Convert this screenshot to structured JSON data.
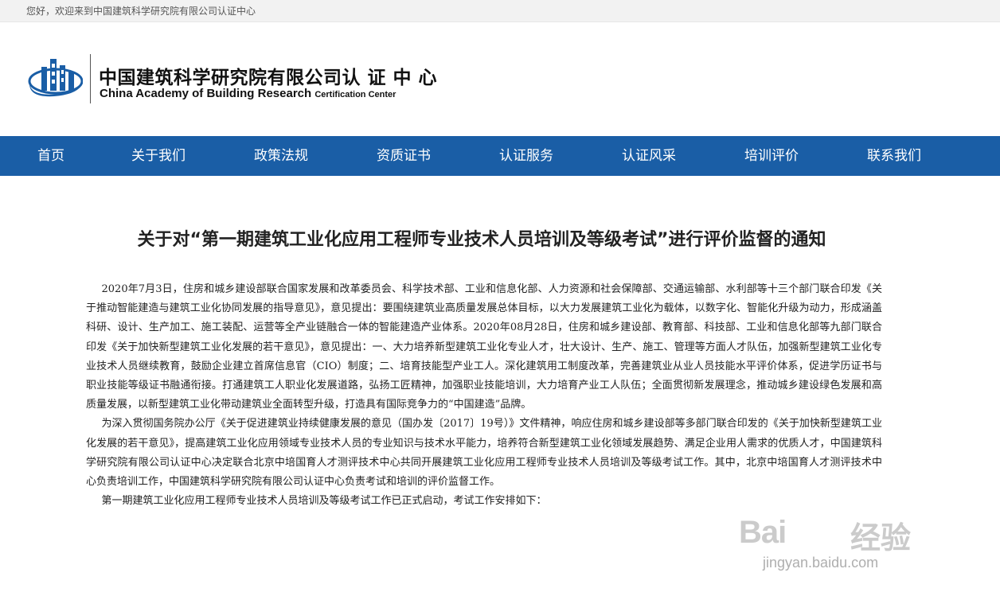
{
  "topbar": {
    "welcome": "您好，欢迎来到中国建筑科学研究院有限公司认证中心"
  },
  "header": {
    "logo_cn": "中国建筑科学研究院有限公司认 证 中 心",
    "logo_en_main": "China Academy of Building Research ",
    "logo_en_small": "Certification Center"
  },
  "nav": {
    "items": [
      {
        "label": "首页"
      },
      {
        "label": "关于我们"
      },
      {
        "label": "政策法规"
      },
      {
        "label": "资质证书"
      },
      {
        "label": "认证服务"
      },
      {
        "label": "认证风采"
      },
      {
        "label": "培训评价"
      },
      {
        "label": "联系我们"
      }
    ]
  },
  "article": {
    "title": "关于对“第一期建筑工业化应用工程师专业技术人员培训及等级考试”进行评价监督的通知",
    "paragraphs": [
      "2020年7月3日，住房和城乡建设部联合国家发展和改革委员会、科学技术部、工业和信息化部、人力资源和社会保障部、交通运输部、水利部等十三个部门联合印发《关于推动智能建造与建筑工业化协同发展的指导意见》，意见提出：要围绕建筑业高质量发展总体目标，以大力发展建筑工业化为载体，以数字化、智能化升级为动力，形成涵盖科研、设计、生产加工、施工装配、运营等全产业链融合一体的智能建造产业体系。2020年08月28日，住房和城乡建设部、教育部、科技部、工业和信息化部等九部门联合印发《关于加快新型建筑工业化发展的若干意见》，意见提出：一、大力培养新型建筑工业化专业人才，壮大设计、生产、施工、管理等方面人才队伍，加强新型建筑工业化专业技术人员继续教育，鼓励企业建立首席信息官（CIO）制度；二、培育技能型产业工人。深化建筑用工制度改革，完善建筑业从业人员技能水平评价体系，促进学历证书与职业技能等级证书融通衔接。打通建筑工人职业化发展道路，弘扬工匠精神，加强职业技能培训，大力培育产业工人队伍；全面贯彻新发展理念，推动城乡建设绿色发展和高质量发展，以新型建筑工业化带动建筑业全面转型升级，打造具有国际竞争力的“中国建造”品牌。",
      "为深入贯彻国务院办公厅《关于促进建筑业持续健康发展的意见（国办发〔2017〕19号）》文件精神，响应住房和城乡建设部等多部门联合印发的《关于加快新型建筑工业化发展的若干意见》，提高建筑工业化应用领域专业技术人员的专业知识与技术水平能力，培养符合新型建筑工业化领域发展趋势、满足企业用人需求的优质人才，中国建筑科学研究院有限公司认证中心决定联合北京中培国育人才测评技术中心共同开展建筑工业化应用工程师专业技术人员培训及等级考试工作。其中，北京中培国育人才测评技术中心负责培训工作，中国建筑科学研究院有限公司认证中心负责考试和培训的评价监督工作。",
      "第一期建筑工业化应用工程师专业技术人员培训及等级考试工作已正式启动，考试工作安排如下："
    ]
  },
  "watermark": {
    "brand": "Bai",
    "brand_cn": "经验",
    "url": "jingyan.baidu.com"
  },
  "colors": {
    "nav_bg": "#1a5ea6",
    "logo_blue": "#1a5ea6"
  }
}
